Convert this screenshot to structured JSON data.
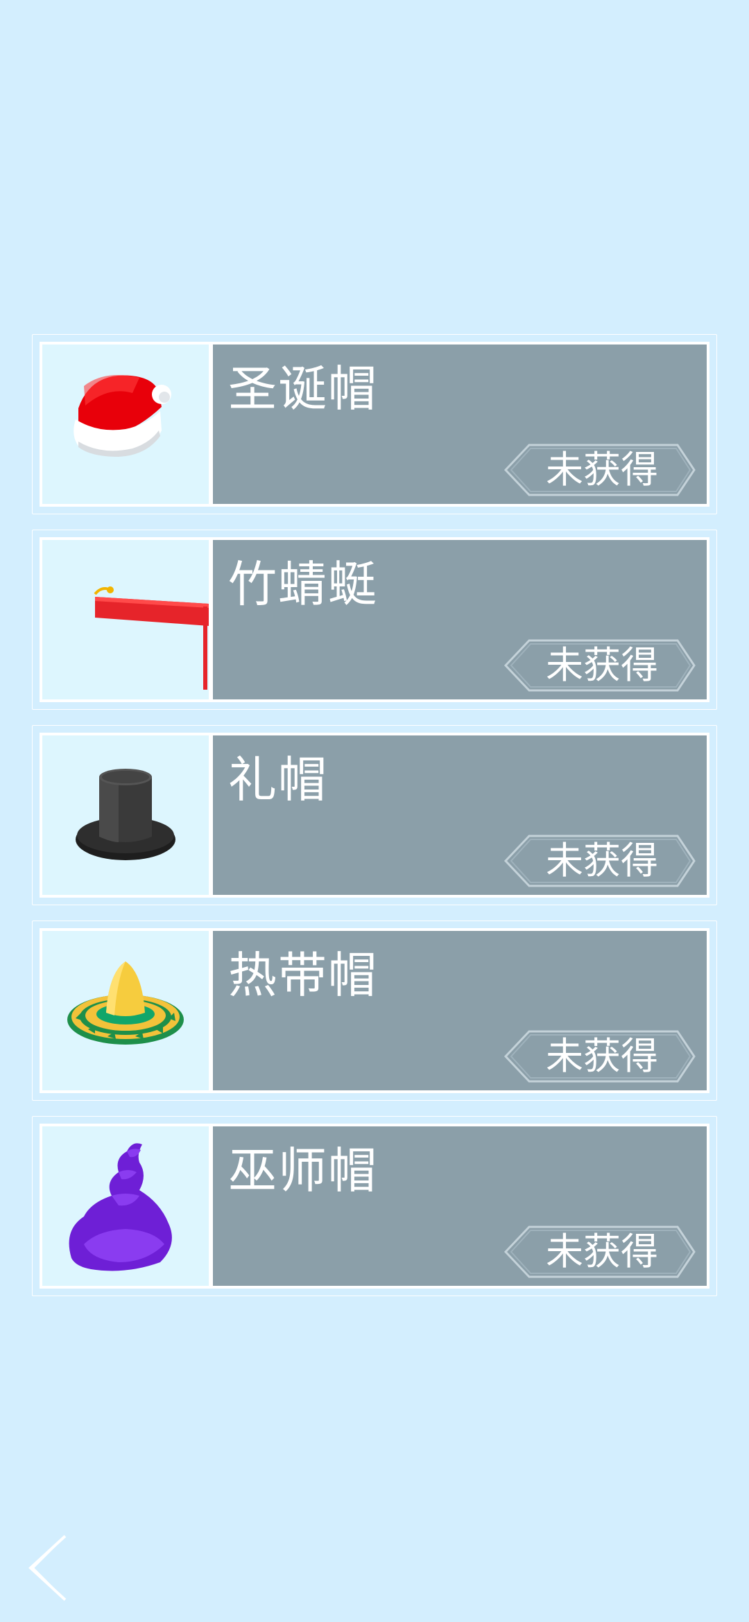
{
  "items": [
    {
      "name": "圣诞帽",
      "status": "未获得",
      "icon": "santa-hat-icon"
    },
    {
      "name": "竹蜻蜓",
      "status": "未获得",
      "icon": "bamboo-copter-icon"
    },
    {
      "name": "礼帽",
      "status": "未获得",
      "icon": "top-hat-icon"
    },
    {
      "name": "热带帽",
      "status": "未获得",
      "icon": "sombrero-icon"
    },
    {
      "name": "巫师帽",
      "status": "未获得",
      "icon": "wizard-hat-icon"
    }
  ],
  "nav": {
    "back_icon": "back-chevron-icon"
  },
  "colors": {
    "background": "#D3EEFE",
    "card_info": "#8B9FA9",
    "thumb_background": "#DDF6FE"
  }
}
